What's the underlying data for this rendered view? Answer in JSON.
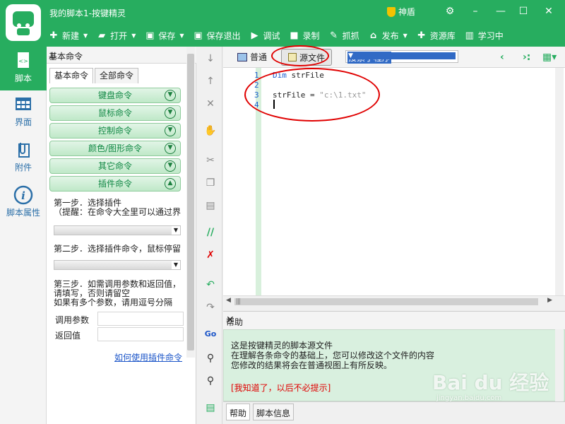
{
  "app": {
    "title": "我的脚本1-按键精灵",
    "shendun": "神盾",
    "colors": {
      "accent": "#27ad5f",
      "highlight": "#e00000"
    }
  },
  "toolbar": {
    "items": [
      {
        "icon": "plus-icon",
        "label": "新建"
      },
      {
        "icon": "folder-open-icon",
        "label": "打开"
      },
      {
        "icon": "save-icon",
        "label": "保存"
      },
      {
        "icon": "save-exit-icon",
        "label": "保存退出"
      },
      {
        "icon": "play-icon",
        "label": "调试"
      },
      {
        "icon": "record-icon",
        "label": "录制"
      },
      {
        "icon": "grab-icon",
        "label": "抓抓"
      },
      {
        "icon": "publish-icon",
        "label": "发布"
      },
      {
        "icon": "resource-icon",
        "label": "资源库"
      },
      {
        "icon": "learn-icon",
        "label": "学习中"
      }
    ]
  },
  "leftnav": {
    "items": [
      {
        "icon": "script-icon",
        "label": "脚本"
      },
      {
        "icon": "ui-grid-icon",
        "label": "界面"
      },
      {
        "icon": "paperclip-icon",
        "label": "附件"
      },
      {
        "icon": "info-icon",
        "label": "脚本属性"
      }
    ]
  },
  "command_panel": {
    "title": "基本命令",
    "tabs": [
      "基本命令",
      "全部命令"
    ],
    "commands": [
      "键盘命令",
      "鼠标命令",
      "控制命令",
      "颜色/图形命令",
      "其它命令",
      "插件命令"
    ],
    "step1": "第一步．选择插件",
    "step1_hint": "（提醒：在命令大全里可以通过界",
    "step2": "第二步．选择插件命令，鼠标停留",
    "step3_l1": "第三步．如需调用参数和返回值，",
    "step3_l2": "请填写，否则请留空",
    "step3_l3": "如果有多个参数，请用逗号分隔",
    "param_call": "调用参数",
    "param_return": "返回值",
    "help_link": "如何使用插件命令"
  },
  "editor": {
    "mode_normal": "普通",
    "mode_source": "源文件",
    "search_placeholder": "搜索子程序",
    "line_numbers": [
      "1",
      "2",
      "3",
      "4"
    ],
    "line1_kw": "Dim",
    "line1_rest": " strFile",
    "line3_var": "strFile = ",
    "line3_str": "\"c:\\1.txt\""
  },
  "help": {
    "title": "帮助",
    "line1": "这是按键精灵的脚本源文件",
    "line2": "在理解各条命令的基础上，您可以修改这个文件的内容",
    "line3": "您修改的结果将会在普通视图上有所反映。",
    "dismiss": "[我知道了，以后不必提示]",
    "tabs": [
      "帮助",
      "脚本信息"
    ]
  },
  "watermark": {
    "text": "Bai du 经验",
    "url": "jingyan.baidu.com"
  }
}
